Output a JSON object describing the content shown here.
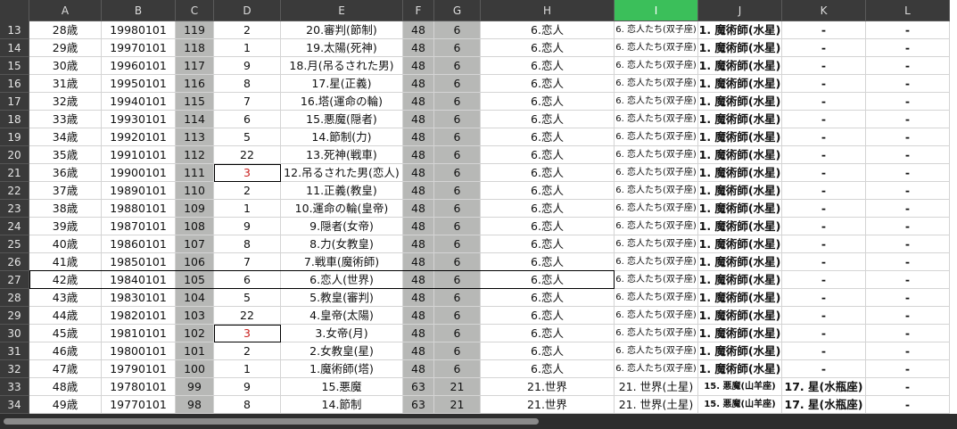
{
  "columns": [
    "A",
    "B",
    "C",
    "D",
    "E",
    "F",
    "G",
    "H",
    "I",
    "J",
    "K",
    "L"
  ],
  "selected_column": "I",
  "rows": [
    {
      "n": "13",
      "A": "28歳",
      "B": "19980101",
      "C": "119",
      "D": "2",
      "E": "20.審判(節制)",
      "F": "48",
      "G": "6",
      "H": "6.恋人",
      "I": "6. 恋人たち(双子座)",
      "J": "1. 魔術師(水星)",
      "K": "-",
      "L": "-"
    },
    {
      "n": "14",
      "A": "29歳",
      "B": "19970101",
      "C": "118",
      "D": "1",
      "E": "19.太陽(死神)",
      "F": "48",
      "G": "6",
      "H": "6.恋人",
      "I": "6. 恋人たち(双子座)",
      "J": "1. 魔術師(水星)",
      "K": "-",
      "L": "-"
    },
    {
      "n": "15",
      "A": "30歳",
      "B": "19960101",
      "C": "117",
      "D": "9",
      "E": "18.月(吊るされた男)",
      "F": "48",
      "G": "6",
      "H": "6.恋人",
      "I": "6. 恋人たち(双子座)",
      "J": "1. 魔術師(水星)",
      "K": "-",
      "L": "-"
    },
    {
      "n": "16",
      "A": "31歳",
      "B": "19950101",
      "C": "116",
      "D": "8",
      "E": "17.星(正義)",
      "F": "48",
      "G": "6",
      "H": "6.恋人",
      "I": "6. 恋人たち(双子座)",
      "J": "1. 魔術師(水星)",
      "K": "-",
      "L": "-"
    },
    {
      "n": "17",
      "A": "32歳",
      "B": "19940101",
      "C": "115",
      "D": "7",
      "E": "16.塔(運命の輪)",
      "F": "48",
      "G": "6",
      "H": "6.恋人",
      "I": "6. 恋人たち(双子座)",
      "J": "1. 魔術師(水星)",
      "K": "-",
      "L": "-"
    },
    {
      "n": "18",
      "A": "33歳",
      "B": "19930101",
      "C": "114",
      "D": "6",
      "E": "15.悪魔(隠者)",
      "F": "48",
      "G": "6",
      "H": "6.恋人",
      "I": "6. 恋人たち(双子座)",
      "J": "1. 魔術師(水星)",
      "K": "-",
      "L": "-"
    },
    {
      "n": "19",
      "A": "34歳",
      "B": "19920101",
      "C": "113",
      "D": "5",
      "E": "14.節制(力)",
      "F": "48",
      "G": "6",
      "H": "6.恋人",
      "I": "6. 恋人たち(双子座)",
      "J": "1. 魔術師(水星)",
      "K": "-",
      "L": "-"
    },
    {
      "n": "20",
      "A": "35歳",
      "B": "19910101",
      "C": "112",
      "D": "22",
      "E": "13.死神(戦車)",
      "F": "48",
      "G": "6",
      "H": "6.恋人",
      "I": "6. 恋人たち(双子座)",
      "J": "1. 魔術師(水星)",
      "K": "-",
      "L": "-"
    },
    {
      "n": "21",
      "A": "36歳",
      "B": "19900101",
      "C": "111",
      "D": "3",
      "E": "12.吊るされた男(恋人)",
      "F": "48",
      "G": "6",
      "H": "6.恋人",
      "I": "6. 恋人たち(双子座)",
      "J": "1. 魔術師(水星)",
      "K": "-",
      "L": "-"
    },
    {
      "n": "22",
      "A": "37歳",
      "B": "19890101",
      "C": "110",
      "D": "2",
      "E": "11.正義(教皇)",
      "F": "48",
      "G": "6",
      "H": "6.恋人",
      "I": "6. 恋人たち(双子座)",
      "J": "1. 魔術師(水星)",
      "K": "-",
      "L": "-"
    },
    {
      "n": "23",
      "A": "38歳",
      "B": "19880101",
      "C": "109",
      "D": "1",
      "E": "10.運命の輪(皇帝)",
      "F": "48",
      "G": "6",
      "H": "6.恋人",
      "I": "6. 恋人たち(双子座)",
      "J": "1. 魔術師(水星)",
      "K": "-",
      "L": "-"
    },
    {
      "n": "24",
      "A": "39歳",
      "B": "19870101",
      "C": "108",
      "D": "9",
      "E": "9.隠者(女帝)",
      "F": "48",
      "G": "6",
      "H": "6.恋人",
      "I": "6. 恋人たち(双子座)",
      "J": "1. 魔術師(水星)",
      "K": "-",
      "L": "-"
    },
    {
      "n": "25",
      "A": "40歳",
      "B": "19860101",
      "C": "107",
      "D": "8",
      "E": "8.力(女教皇)",
      "F": "48",
      "G": "6",
      "H": "6.恋人",
      "I": "6. 恋人たち(双子座)",
      "J": "1. 魔術師(水星)",
      "K": "-",
      "L": "-"
    },
    {
      "n": "26",
      "A": "41歳",
      "B": "19850101",
      "C": "106",
      "D": "7",
      "E": "7.戦車(魔術師)",
      "F": "48",
      "G": "6",
      "H": "6.恋人",
      "I": "6. 恋人たち(双子座)",
      "J": "1. 魔術師(水星)",
      "K": "-",
      "L": "-"
    },
    {
      "n": "27",
      "A": "42歳",
      "B": "19840101",
      "C": "105",
      "D": "6",
      "E": "6.恋人(世界)",
      "F": "48",
      "G": "6",
      "H": "6.恋人",
      "I": "6. 恋人たち(双子座)",
      "J": "1. 魔術師(水星)",
      "K": "-",
      "L": "-"
    },
    {
      "n": "28",
      "A": "43歳",
      "B": "19830101",
      "C": "104",
      "D": "5",
      "E": "5.教皇(審判)",
      "F": "48",
      "G": "6",
      "H": "6.恋人",
      "I": "6. 恋人たち(双子座)",
      "J": "1. 魔術師(水星)",
      "K": "-",
      "L": "-"
    },
    {
      "n": "29",
      "A": "44歳",
      "B": "19820101",
      "C": "103",
      "D": "22",
      "E": "4.皇帝(太陽)",
      "F": "48",
      "G": "6",
      "H": "6.恋人",
      "I": "6. 恋人たち(双子座)",
      "J": "1. 魔術師(水星)",
      "K": "-",
      "L": "-"
    },
    {
      "n": "30",
      "A": "45歳",
      "B": "19810101",
      "C": "102",
      "D": "3",
      "E": "3.女帝(月)",
      "F": "48",
      "G": "6",
      "H": "6.恋人",
      "I": "6. 恋人たち(双子座)",
      "J": "1. 魔術師(水星)",
      "K": "-",
      "L": "-"
    },
    {
      "n": "31",
      "A": "46歳",
      "B": "19800101",
      "C": "101",
      "D": "2",
      "E": "2.女教皇(星)",
      "F": "48",
      "G": "6",
      "H": "6.恋人",
      "I": "6. 恋人たち(双子座)",
      "J": "1. 魔術師(水星)",
      "K": "-",
      "L": "-"
    },
    {
      "n": "32",
      "A": "47歳",
      "B": "19790101",
      "C": "100",
      "D": "1",
      "E": "1.魔術師(塔)",
      "F": "48",
      "G": "6",
      "H": "6.恋人",
      "I": "6. 恋人たち(双子座)",
      "J": "1. 魔術師(水星)",
      "K": "-",
      "L": "-"
    },
    {
      "n": "33",
      "A": "48歳",
      "B": "19780101",
      "C": "99",
      "D": "9",
      "E": "15.悪魔",
      "F": "63",
      "G": "21",
      "H": "21.世界",
      "I": "21. 世界(土星)",
      "J": "15. 悪魔(山羊座)",
      "K": "17. 星(水瓶座)",
      "L": "-"
    },
    {
      "n": "34",
      "A": "49歳",
      "B": "19770101",
      "C": "98",
      "D": "8",
      "E": "14.節制",
      "F": "63",
      "G": "21",
      "H": "21.世界",
      "I": "21. 世界(土星)",
      "J": "15. 悪魔(山羊座)",
      "K": "17. 星(水瓶座)",
      "L": "-"
    }
  ],
  "colors": {
    "header_bg": "#3a3a3a",
    "selected_header": "#3bbf5a",
    "gray_column": "#b7b8b6",
    "red_text": "#c9211e"
  }
}
